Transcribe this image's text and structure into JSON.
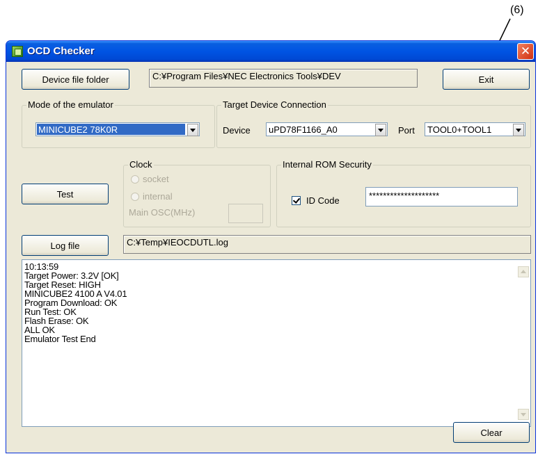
{
  "callout": {
    "label": "(6)"
  },
  "window": {
    "title": "OCD Checker",
    "close_glyph": "✕"
  },
  "device_folder": {
    "button_label": "Device file folder",
    "path": "C:¥Program Files¥NEC Electronics Tools¥DEV"
  },
  "exit_button": {
    "label": "Exit"
  },
  "emulator_mode": {
    "legend": "Mode of the emulator",
    "selected": "MINICUBE2 78K0R"
  },
  "target_connection": {
    "legend": "Target Device Connection",
    "device_label": "Device",
    "device_selected": "uPD78F1166_A0",
    "port_label": "Port",
    "port_selected": "TOOL0+TOOL1"
  },
  "test_button": {
    "label": "Test"
  },
  "clock": {
    "legend": "Clock",
    "option_socket": "socket",
    "option_internal": "internal",
    "main_osc_label": "Main OSC(MHz)",
    "main_osc_value": ""
  },
  "rom_security": {
    "legend": "Internal ROM Security",
    "id_code_label": "ID Code",
    "id_code_checked": true,
    "id_code_value": "********************"
  },
  "log_file": {
    "button_label": "Log file",
    "path": "C:¥Temp¥IEOCDUTL.log"
  },
  "log_output": {
    "lines": [
      "10:13:59",
      "Target Power: 3.2V [OK]",
      "Target Reset: HIGH",
      "MINICUBE2 4100 A V4.01",
      "Program Download: OK",
      "Run Test:  OK",
      "Flash Erase: OK",
      "ALL OK",
      "Emulator Test End"
    ]
  },
  "clear_button": {
    "label": "Clear"
  },
  "icons": {
    "app": "app-icon",
    "close": "close-icon",
    "dropdown": "chevron-down-icon",
    "scroll_up": "scroll-up-arrow-icon",
    "scroll_down": "scroll-down-arrow-icon",
    "callout_arrow": "callout-arrow-icon"
  },
  "colors": {
    "titlebar": "#0054e3",
    "window_bg": "#ece9d8",
    "selection": "#316ac5",
    "close_button": "#e0481f"
  }
}
